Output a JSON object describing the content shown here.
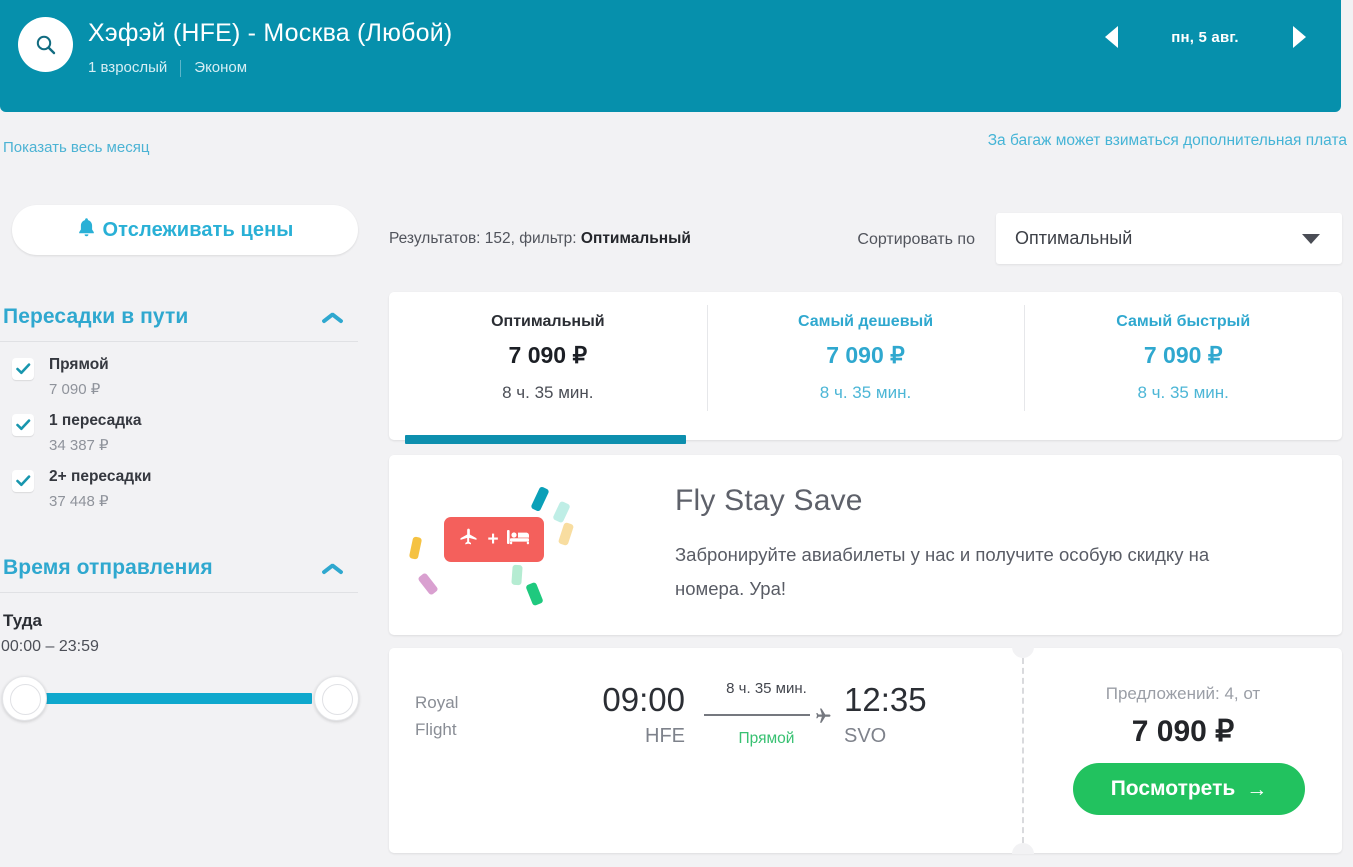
{
  "header": {
    "search_icon": "search-icon",
    "route": "Хэфэй (HFE) - Москва (Любой)",
    "passengers": "1 взрослый",
    "cabin_class": "Эконом",
    "date_label": "пн, 5 авг.",
    "prev_icon": "triangle-left-icon",
    "next_icon": "triangle-right-icon",
    "bg_color": "#0690ac"
  },
  "subheader": {
    "show_month_link": "Показать весь месяц",
    "baggage_note": "За багаж может взиматься дополнительная плата"
  },
  "toolbar": {
    "track_prices_label": "Отслеживать цены",
    "track_icon": "bell-icon",
    "results_prefix": "Результатов: 152, фильтр:",
    "results_filter": "Оптимальный",
    "sort_label": "Сортировать по",
    "sort_value": "Оптимальный",
    "sort_caret_icon": "chevron-down-icon"
  },
  "sidebar": {
    "stops_filter": {
      "title": "Пересадки в пути",
      "collapse_icon": "chevron-up-icon",
      "options": [
        {
          "label": "Прямой",
          "price": "7 090 ₽",
          "checked": true
        },
        {
          "label": "1 пересадка",
          "price": "34 387 ₽",
          "checked": true
        },
        {
          "label": "2+ пересадки",
          "price": "37 448 ₽",
          "checked": true
        }
      ]
    },
    "time_filter": {
      "title": "Время отправления",
      "collapse_icon": "chevron-up-icon",
      "direction_label": "Туда",
      "range_text": "00:00 – 23:59"
    }
  },
  "tabs": [
    {
      "name": "Оптимальный",
      "price": "7 090 ₽",
      "duration": "8 ч. 35 мин.",
      "active": true
    },
    {
      "name": "Самый дешевый",
      "price": "7 090 ₽",
      "duration": "8 ч. 35 мин.",
      "active": false
    },
    {
      "name": "Самый быстрый",
      "price": "7 090 ₽",
      "duration": "8 ч. 35 мин.",
      "active": false
    }
  ],
  "promo": {
    "title": "Fly Stay Save",
    "description": "Забронируйте авиабилеты у нас и получите особую скидку на номера. Ура!",
    "badge_plane_icon": "airplane-icon",
    "badge_plus": "+",
    "badge_bed_icon": "bed-icon",
    "badge_color": "#f4605c"
  },
  "flight": {
    "airline": "Royal\nFlight",
    "airline_line1": "Royal",
    "airline_line2": "Flight",
    "depart_time": "09:00",
    "depart_code": "HFE",
    "arrive_time": "12:35",
    "arrive_code": "SVO",
    "duration": "8 ч. 35 мин.",
    "stops": "Прямой",
    "plane_icon": "airplane-icon",
    "offers_label": "Предложений: 4, от",
    "price": "7 090 ₽",
    "cta_label": "Посмотреть",
    "cta_arrow": "→",
    "cta_color": "#22c25f"
  }
}
